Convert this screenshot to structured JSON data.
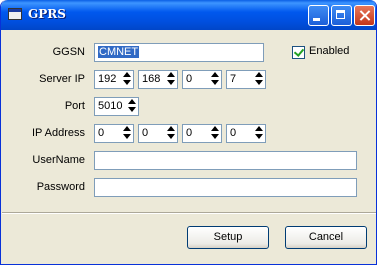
{
  "window": {
    "title": "GPRS"
  },
  "form": {
    "ggsn_label": "GGSN",
    "ggsn_value": "CMNET",
    "enabled_label": "Enabled",
    "enabled_checked": true,
    "server_ip_label": "Server IP",
    "server_ip": [
      "192",
      "168",
      "0",
      "7"
    ],
    "port_label": "Port",
    "port_value": "5010",
    "ip_address_label": "IP Address",
    "ip_address": [
      "0",
      "0",
      "0",
      "0"
    ],
    "username_label": "UserName",
    "username_value": "",
    "password_label": "Password",
    "password_value": ""
  },
  "buttons": {
    "setup": "Setup",
    "cancel": "Cancel"
  }
}
